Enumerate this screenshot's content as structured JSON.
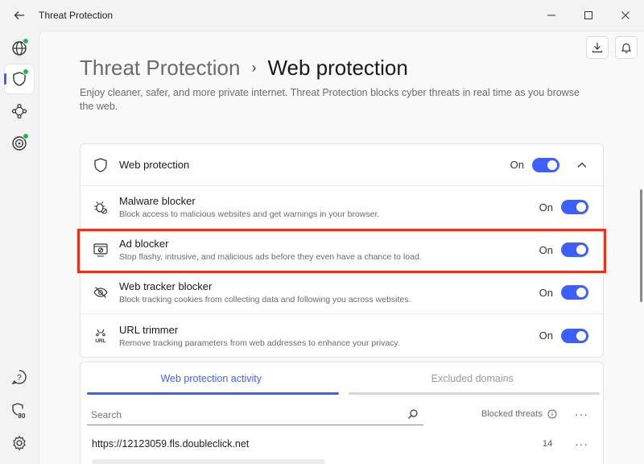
{
  "window": {
    "title": "Threat Protection",
    "back_icon": "arrow-left-icon",
    "controls": [
      "minimize",
      "maximize",
      "close"
    ]
  },
  "rail": {
    "items": [
      {
        "icon": "globe-icon",
        "badge": true
      },
      {
        "icon": "shield-icon",
        "badge": true,
        "active": true
      },
      {
        "icon": "meshnet-icon",
        "badge": false
      },
      {
        "icon": "target-icon",
        "badge": true
      }
    ],
    "bottom": [
      {
        "icon": "help-icon"
      },
      {
        "icon": "security-score-icon",
        "label": "80"
      },
      {
        "icon": "settings-icon"
      }
    ]
  },
  "breadcrumb": {
    "parent": "Threat Protection",
    "separator": "›",
    "current": "Web protection"
  },
  "description": "Enjoy cleaner, safer, and more private internet. Threat Protection blocks cyber threats in real time as you browse the web.",
  "web_protection": {
    "label": "Web protection",
    "state": "On",
    "items": [
      {
        "title": "Malware blocker",
        "subtitle": "Block access to malicious websites and get warnings in your browser.",
        "state": "On"
      },
      {
        "title": "Ad blocker",
        "subtitle": "Stop flashy, intrusive, and malicious ads before they even have a chance to load.",
        "state": "On"
      },
      {
        "title": "Web tracker blocker",
        "subtitle": "Block tracking cookies from collecting data and following you across websites.",
        "state": "On"
      },
      {
        "title": "URL trimmer",
        "subtitle": "Remove tracking parameters from web addresses to enhance your privacy.",
        "state": "On"
      }
    ],
    "url_icon_text": "URL"
  },
  "activity": {
    "tabs": [
      "Web protection activity",
      "Excluded domains"
    ],
    "search_placeholder": "Search",
    "column_header": "Blocked threats",
    "more": "···",
    "rows": [
      {
        "url": "https://12123059.fls.doubleclick.net",
        "count": "14"
      }
    ]
  },
  "colors": {
    "accent": "#3e5fff",
    "badge": "#1fb84f",
    "highlight": "#e8321c"
  }
}
